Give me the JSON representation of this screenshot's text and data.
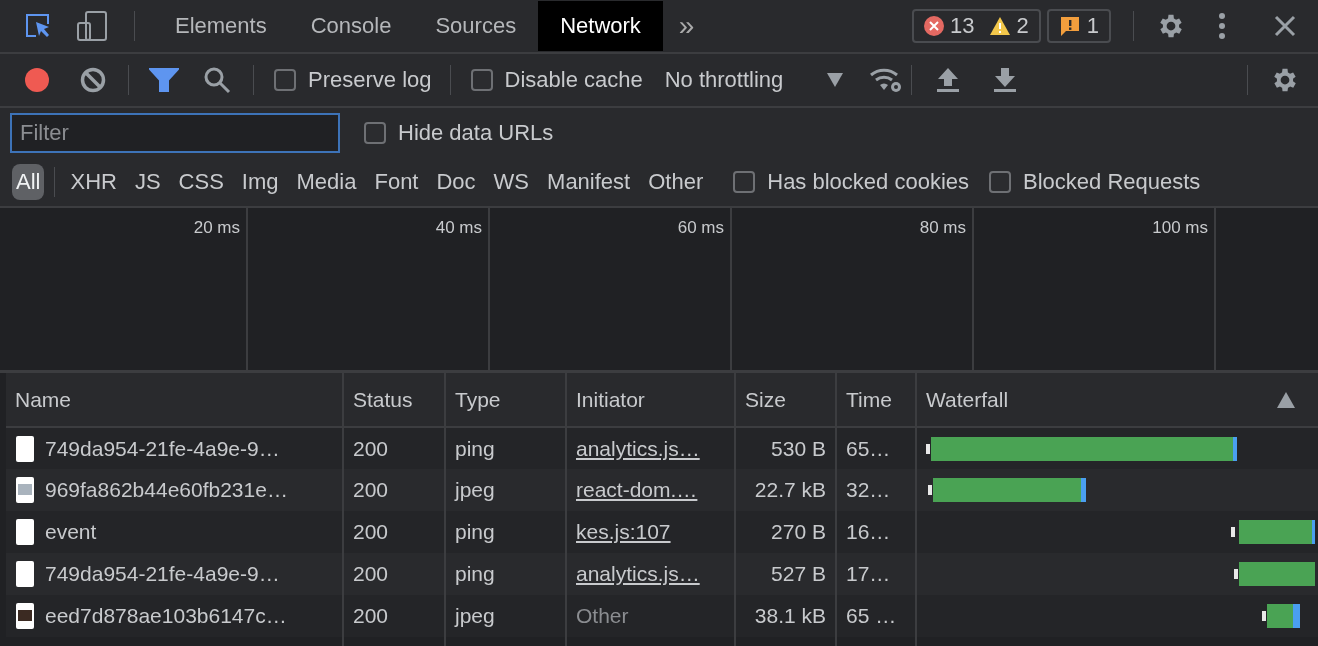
{
  "tabs": [
    {
      "label": "Elements",
      "selected": false
    },
    {
      "label": "Console",
      "selected": false
    },
    {
      "label": "Sources",
      "selected": false
    },
    {
      "label": "Network",
      "selected": true
    }
  ],
  "more_tabs": "»",
  "counts": {
    "errors": "13",
    "warnings": "2",
    "issues": "1"
  },
  "toolbar": {
    "recording": true,
    "filter_active": true,
    "preserve_log": {
      "label": "Preserve log",
      "checked": false
    },
    "disable_cache": {
      "label": "Disable cache",
      "checked": false
    },
    "throttling": "No throttling"
  },
  "filter": {
    "placeholder": "Filter"
  },
  "hide_data_urls": {
    "label": "Hide data URLs",
    "checked": false
  },
  "type_filters": [
    {
      "label": "All",
      "selected": true
    },
    {
      "label": "XHR",
      "selected": false
    },
    {
      "label": "JS",
      "selected": false
    },
    {
      "label": "CSS",
      "selected": false
    },
    {
      "label": "Img",
      "selected": false
    },
    {
      "label": "Media",
      "selected": false
    },
    {
      "label": "Font",
      "selected": false
    },
    {
      "label": "Doc",
      "selected": false
    },
    {
      "label": "WS",
      "selected": false
    },
    {
      "label": "Manifest",
      "selected": false
    },
    {
      "label": "Other",
      "selected": false
    }
  ],
  "has_blocked_cookies": {
    "label": "Has blocked cookies",
    "checked": false
  },
  "blocked_requests": {
    "label": "Blocked Requests",
    "checked": false
  },
  "overview": {
    "ticks": [
      "20 ms",
      "40 ms",
      "60 ms",
      "80 ms",
      "100 ms"
    ]
  },
  "table": {
    "columns": [
      "Name",
      "Status",
      "Type",
      "Initiator",
      "Size",
      "Time",
      "Waterfall"
    ],
    "rows": [
      {
        "kind": "document",
        "name": "749da954-21fe-4a9e-9…",
        "status": "200",
        "type": "ping",
        "initiator": "analytics.js…",
        "initiator_link": true,
        "size": "530 B",
        "time": "65…"
      },
      {
        "kind": "image",
        "name": "969fa862b44e60fb231e…",
        "status": "200",
        "type": "jpeg",
        "initiator": "react-dom.…",
        "initiator_link": true,
        "size": "22.7 kB",
        "time": "32…"
      },
      {
        "kind": "document",
        "name": "event",
        "status": "200",
        "type": "ping",
        "initiator": "kes.js:107",
        "initiator_link": true,
        "size": "270 B",
        "time": "16…"
      },
      {
        "kind": "document",
        "name": "749da954-21fe-4a9e-9…",
        "status": "200",
        "type": "ping",
        "initiator": "analytics.js…",
        "initiator_link": true,
        "size": "527 B",
        "time": "17…"
      },
      {
        "kind": "photo",
        "name": "eed7d878ae103b6147c…",
        "status": "200",
        "type": "jpeg",
        "initiator": "Other",
        "initiator_link": false,
        "size": "38.1 kB",
        "time": "65 …"
      }
    ]
  }
}
